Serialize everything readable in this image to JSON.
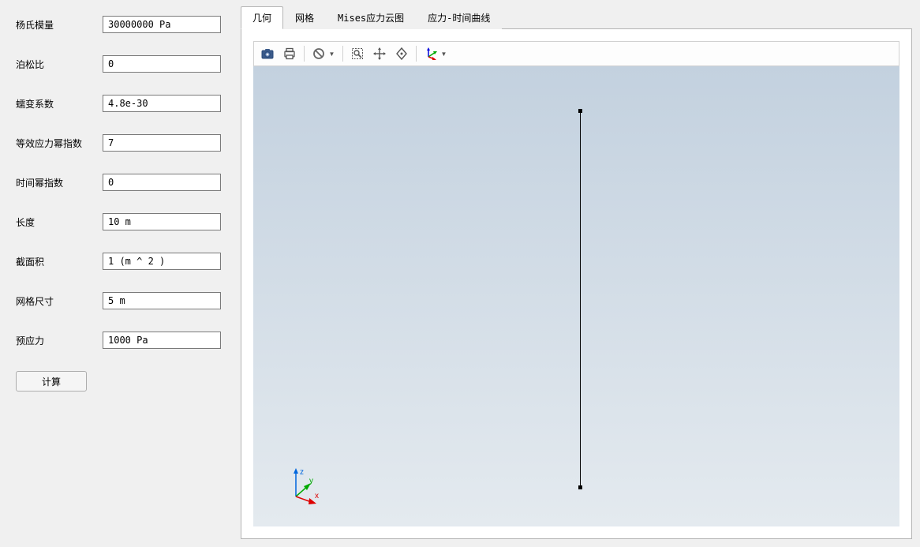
{
  "form": {
    "fields": [
      {
        "label": "杨氏模量",
        "value": "30000000 Pa",
        "name": "youngs-modulus"
      },
      {
        "label": "泊松比",
        "value": "0",
        "name": "poissons-ratio"
      },
      {
        "label": "蠕变系数",
        "value": "4.8e-30",
        "name": "creep-coefficient"
      },
      {
        "label": "等效应力幂指数",
        "value": "7",
        "name": "equiv-stress-exponent"
      },
      {
        "label": "时间幂指数",
        "value": "0",
        "name": "time-exponent"
      },
      {
        "label": "长度",
        "value": "10 m",
        "name": "length"
      },
      {
        "label": "截面积",
        "value": "1 (m ^ 2 )",
        "name": "cross-section-area"
      },
      {
        "label": "网格尺寸",
        "value": "5 m",
        "name": "mesh-size"
      },
      {
        "label": "预应力",
        "value": "1000 Pa",
        "name": "prestress"
      }
    ],
    "compute_button": "计算"
  },
  "tabs": [
    {
      "label": "几何",
      "active": true
    },
    {
      "label": "网格",
      "active": false
    },
    {
      "label": "Mises应力云图",
      "active": false
    },
    {
      "label": "应力-时间曲线",
      "active": false
    }
  ],
  "toolbar": {
    "icons": [
      {
        "name": "camera-icon",
        "type": "camera"
      },
      {
        "name": "print-icon",
        "type": "print"
      },
      {
        "sep": true
      },
      {
        "name": "reset-view-icon",
        "type": "reset",
        "dropdown": true
      },
      {
        "sep": true
      },
      {
        "name": "zoom-window-icon",
        "type": "zoom-window"
      },
      {
        "name": "pan-icon",
        "type": "pan"
      },
      {
        "name": "rotate-icon",
        "type": "rotate"
      },
      {
        "sep": true
      },
      {
        "name": "axis-triad-icon",
        "type": "triad",
        "dropdown": true
      }
    ]
  },
  "axis": {
    "z": "z",
    "y": "y",
    "x": "x"
  }
}
